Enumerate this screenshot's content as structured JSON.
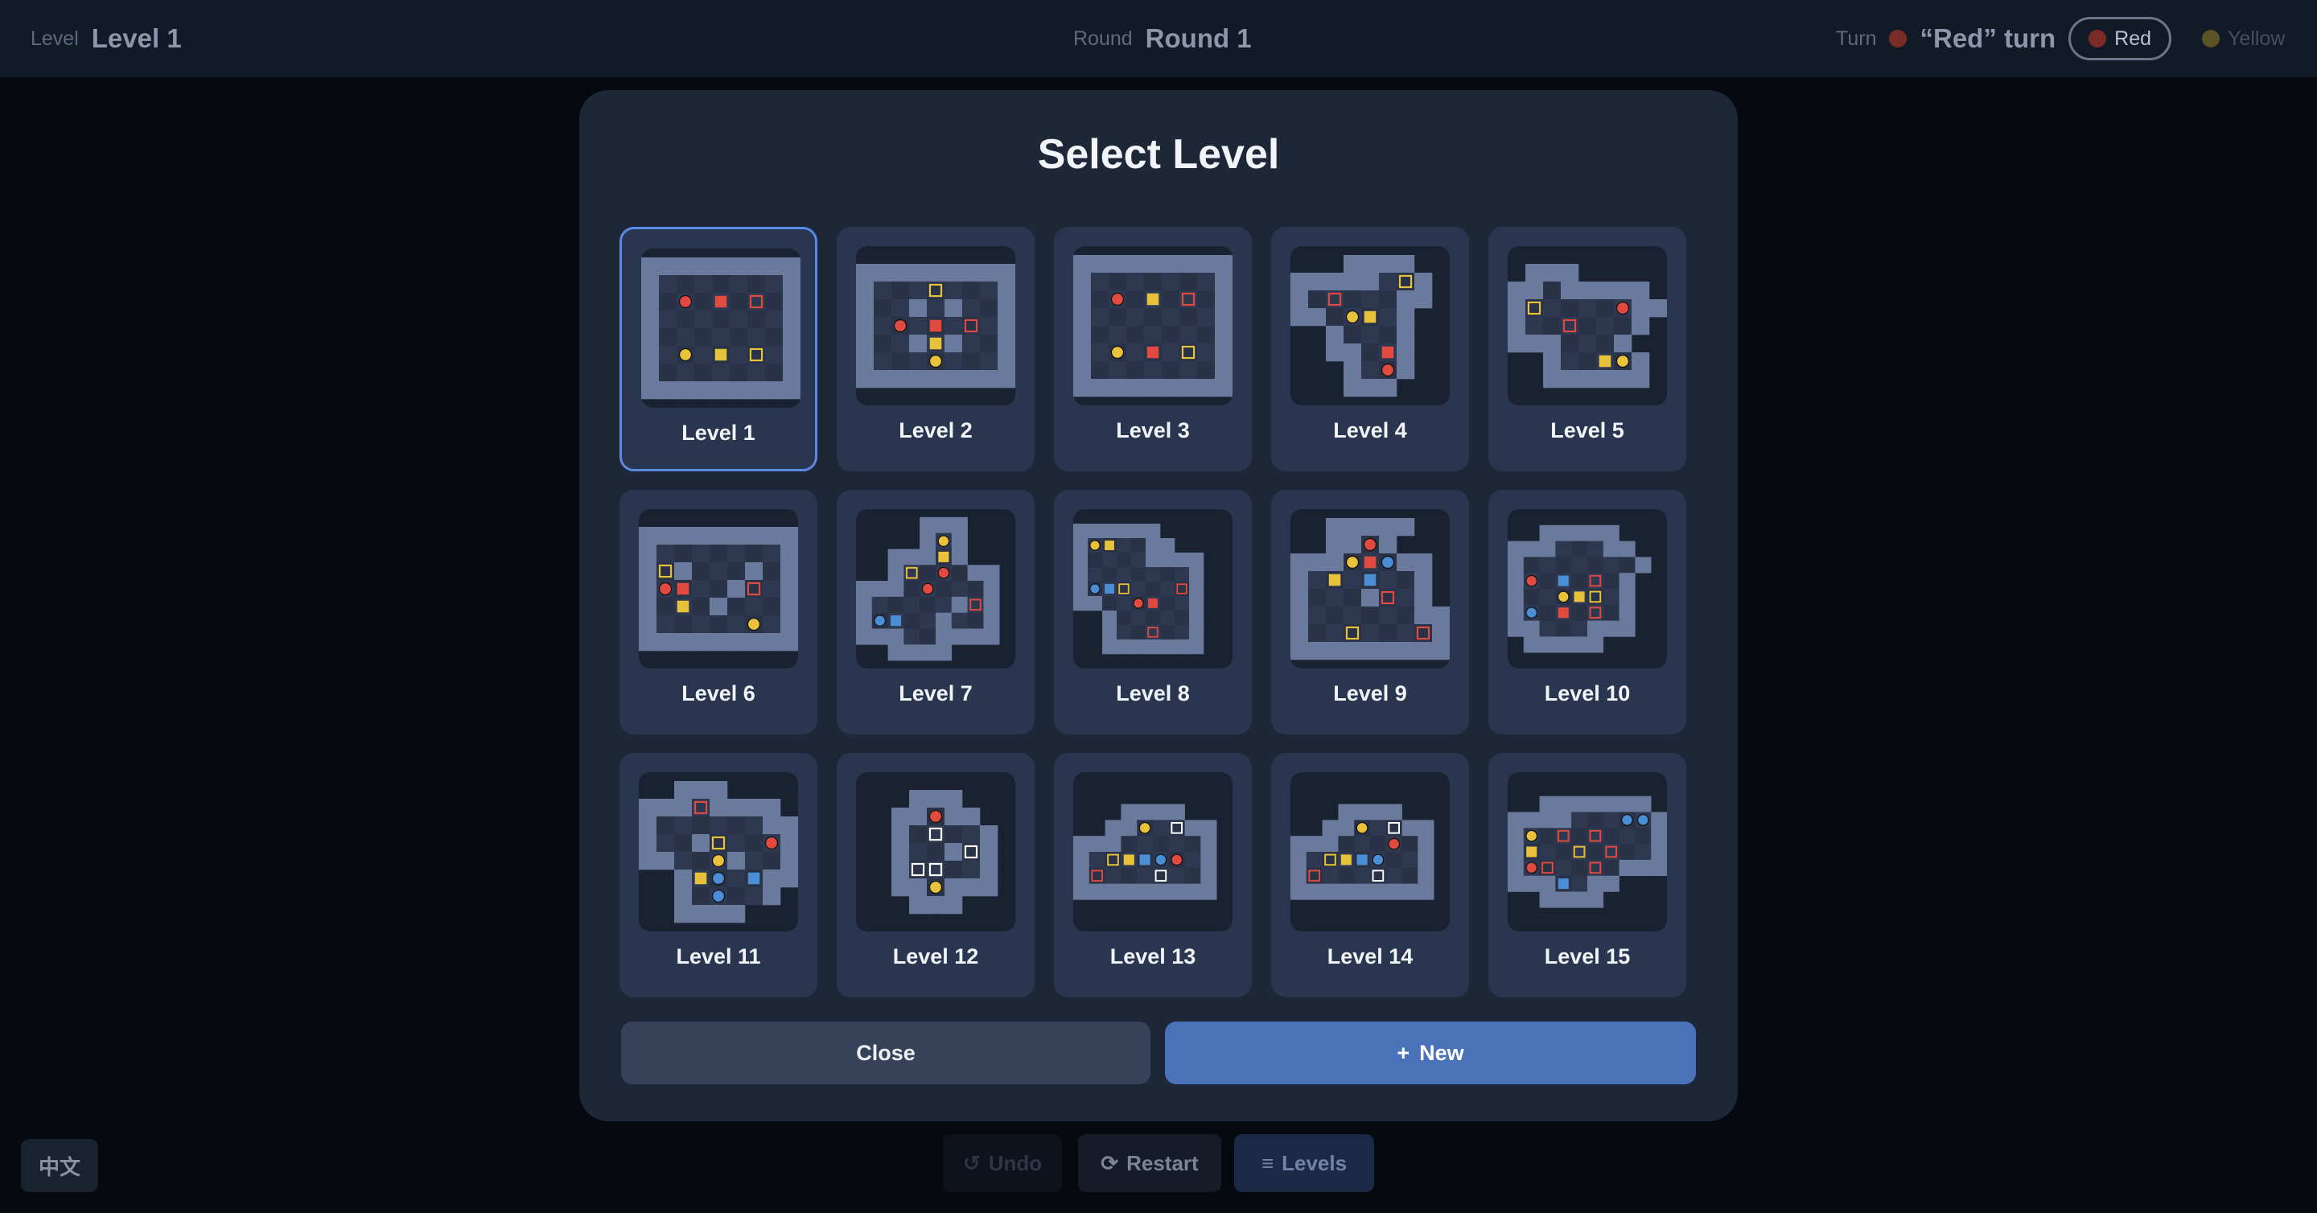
{
  "header": {
    "level_label": "Level",
    "level_value": "Level 1",
    "round_label": "Round",
    "round_value": "Round 1",
    "turn_label": "Turn",
    "turn_value": "“Red” turn",
    "players": [
      {
        "name": "Red",
        "color": "#e04a3f",
        "active": true
      },
      {
        "name": "Yellow",
        "color": "#e8c23a",
        "active": false
      }
    ]
  },
  "controls": {
    "language": "中文",
    "undo": "Undo",
    "restart": "Restart",
    "levels": "Levels"
  },
  "modal": {
    "title": "Select Level",
    "close_label": "Close",
    "new_label": "New",
    "selected_level": "Level 1"
  },
  "levels": [
    {
      "name": "Level 1",
      "map": [
        "#########",
        "#.......#",
        "#.S.B.R.#",
        "#.......#",
        "#.......#",
        "#.T.C.Y.#",
        "#.......#",
        "#########"
      ]
    },
    {
      "name": "Level 2",
      "map": [
        "#########",
        "#...Y...#",
        "#..#.#..#",
        "#.S.B.R.#",
        "#..#C#..#",
        "#...T...#",
        "#########"
      ]
    },
    {
      "name": "Level 3",
      "map": [
        "#########",
        "#.......#",
        "#.S.C.R.#",
        "#.......#",
        "#.......#",
        "#.T.B.Y.#",
        "#.......#",
        "#########"
      ]
    },
    {
      "name": "Level 4",
      "map": [
        "   ####  ",
        "#####.Y# ",
        "#.R...## ",
        "##.TC.#  ",
        "  #...#  ",
        "  ##.B#  ",
        "   #.S#  ",
        "   ###   "
      ]
    },
    {
      "name": "Level 5",
      "map": [
        " ###     ",
        "##.#####",
        "#Y....S##",
        "#..R...#",
        "###...#",
        "  #..CT#",
        "  ######"
      ]
    },
    {
      "name": "Level 6",
      "map": [
        "#########",
        "#.......#",
        "#Y#...#.#",
        "#SB..#R.#",
        "#.C.#...#",
        "#.....T.#",
        "#########"
      ]
    },
    {
      "name": "Level 7",
      "map": [
        "    ###  ",
        "    #T#  ",
        "  ###C#  ",
        "  #Y.S.## ",
        "###.S...#",
        "#.....#R#",
        "#OD..#..#",
        "###..#### ",
        "  ####   "
      ]
    },
    {
      "name": "Level 8",
      "map": [
        "######    ",
        "#TC..##   ",
        "#....#### ",
        "#.......# ",
        "#ODY...R# ",
        "##..SB..# ",
        "  #.....# ",
        "  #..R..# ",
        "  #######  "
      ]
    },
    {
      "name": "Level 9",
      "map": [
        "  #####  ",
        "  ##S#   ",
        "###TBO## ",
        "#.C.D..# ",
        "#...#R.# ",
        "#......##",
        "#..Y...R#",
        "#########"
      ]
    },
    {
      "name": "Level 10",
      "map": [
        "  #####  ",
        "###...## ",
        "#.......# ",
        "#S.D.R.# ",
        "#..TCY.# ",
        "#O.B.R.# ",
        "##...### ",
        " #####   "
      ]
    },
    {
      "name": "Level 11",
      "map": [
        "  ###    ",
        "###R####",
        "#......##",
        "#..#Y..S#",
        "##..T#..#",
        "  #CO.D##",
        "  #.O..# ",
        "  ####   "
      ]
    },
    {
      "name": "Level 12",
      "map": [
        "   ###   ",
        "  ##S##  ",
        "  #.W..# ",
        "  #..#W# ",
        "  #WW..# ",
        "  ##T### ",
        "   ###   "
      ]
    },
    {
      "name": "Level 13",
      "map": [
        "   ####  ",
        "  ##T.W## ",
        "###.....# ",
        "#.YCDOS.# ",
        "#R...W..# ",
        "#########"
      ]
    },
    {
      "name": "Level 14",
      "map": [
        "   ####  ",
        "  ##T.W## ",
        "###...S.# ",
        "#.YCDO..# ",
        "#R...W..# ",
        "#########"
      ]
    },
    {
      "name": "Level 15",
      "map": [
        "          ",
        "  ####### ",
        "####...OO#",
        "#T.R.R...#",
        "#C..Y.R..#",
        "#SR..R.###",
        "###D.##   ",
        "  ####    ",
        "          "
      ]
    }
  ],
  "colors": {
    "red": "#e04a3f",
    "yellow": "#e8c23a",
    "blue": "#4a8fd6",
    "wall": "#6a7a9c",
    "floor": "#293246",
    "accent": "#4a72b8"
  }
}
